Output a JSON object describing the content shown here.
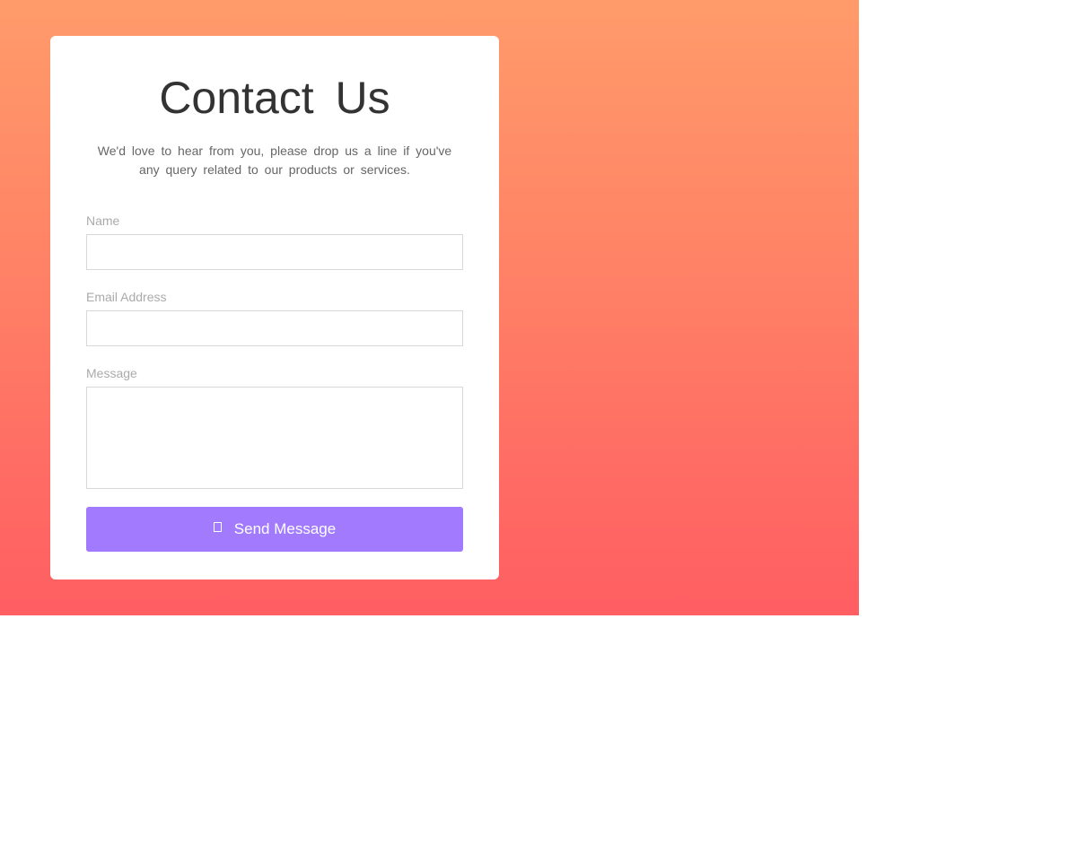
{
  "contact": {
    "title": "Contact Us",
    "subtitle": "We'd love to hear from you, please drop us a line if you've any query related to our products or services.",
    "fields": {
      "name_label": "Name",
      "email_label": "Email Address",
      "message_label": "Message"
    },
    "submit": {
      "label": "Send Message",
      "icon": "send-icon"
    }
  },
  "colors": {
    "gradient_top": "#ff9b6a",
    "gradient_bottom": "#ff5e62",
    "button": "#a17afe",
    "title_text": "#333333"
  }
}
